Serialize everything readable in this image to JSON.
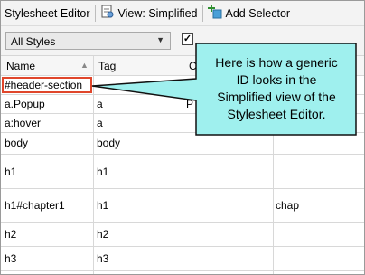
{
  "toolbar": {
    "title": "Stylesheet Editor",
    "view_label": "View: Simplified",
    "add_selector_label": "Add Selector"
  },
  "filter": {
    "selected": "All Styles",
    "checkbox_mark": "✓"
  },
  "table": {
    "headers": [
      "Name",
      "Tag",
      "C"
    ],
    "rows": [
      {
        "name": "#header-section",
        "tag": "",
        "extra": "",
        "extra2": ""
      },
      {
        "name": "a.Popup",
        "tag": "a",
        "extra": "P",
        "extra2": ""
      },
      {
        "name": "a:hover",
        "tag": "a",
        "extra": "",
        "extra2": ""
      },
      {
        "name": "body",
        "tag": "body",
        "extra": "",
        "extra2": ""
      },
      {
        "name": "h1",
        "tag": "h1",
        "extra": "",
        "extra2": ""
      },
      {
        "name": "h1#chapter1",
        "tag": "h1",
        "extra": "",
        "extra2": "chap"
      },
      {
        "name": "h2",
        "tag": "h2",
        "extra": "",
        "extra2": ""
      },
      {
        "name": "h3",
        "tag": "h3",
        "extra": "",
        "extra2": ""
      }
    ]
  },
  "callout": {
    "line1": "Here is how a generic",
    "line2": "ID looks in the",
    "line3": "Simplified view of the",
    "line4": "Stylesheet Editor."
  },
  "colors": {
    "callout_fill": "#9ff0ee",
    "callout_stroke": "#111111",
    "highlight": "#e0462b"
  },
  "icons": {
    "view": "document-view-icon",
    "add_selector": "add-selector-icon"
  }
}
